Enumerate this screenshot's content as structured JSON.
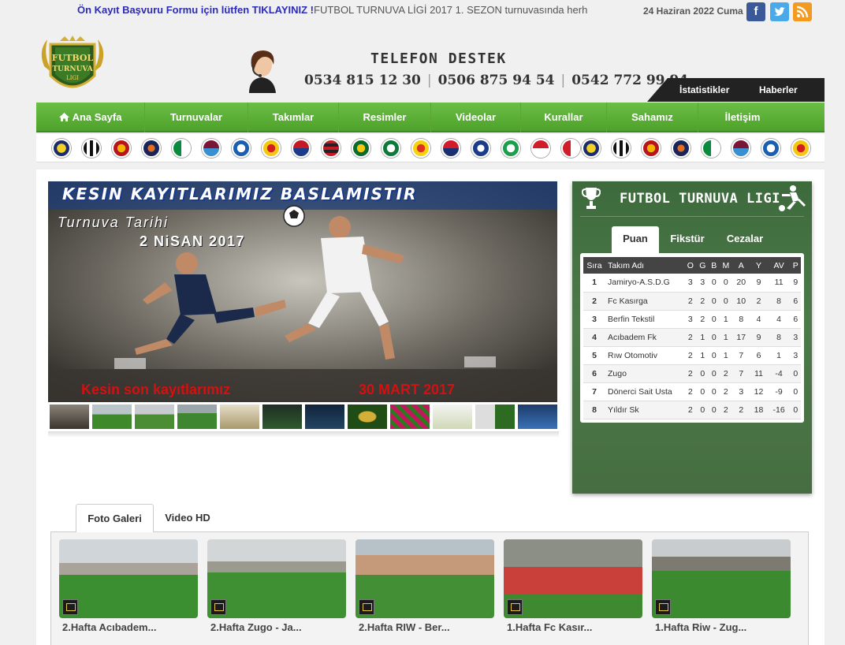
{
  "ticker": {
    "lead": "Ön Kayıt Başvuru Formu için lütfen TIKLAYINIZ !",
    "rest": "FUTBOL TURNUVA LİGİ 2017 1. SEZON turnuvasında herh"
  },
  "date": "24 Haziran 2022 Cuma",
  "social": {
    "facebook": "f",
    "twitter": "t",
    "rss": "rss"
  },
  "logo": {
    "line1": "FUTBOL",
    "line2": "TURNUVA",
    "line3": "LIGI"
  },
  "support": {
    "title": "TELEFON DESTEK",
    "phones": [
      "0534 815 12 30",
      "0506 875 94 54",
      "0542 772 99 94"
    ]
  },
  "subnav": [
    "İstatistikler",
    "Haberler"
  ],
  "nav": [
    "Ana Sayfa",
    "Turnuvalar",
    "Takımlar",
    "Resimler",
    "Videolar",
    "Kurallar",
    "Sahamız",
    "İletişim"
  ],
  "slider": {
    "title": "KESIN KAYITLARIMIZ BASLAMISTIR",
    "subtitle1": "Turnuva Tarihi",
    "subtitle2": "2 NiSAN 2017",
    "bottom_left": "Kesin son kayıtlarımız",
    "bottom_right": "30 MART 2017"
  },
  "league": {
    "title": "FUTBOL TURNUVA LIGI",
    "tabs": [
      "Puan",
      "Fikstür",
      "Cezalar"
    ],
    "columns": [
      "Sıra",
      "Takım Adı",
      "O",
      "G",
      "B",
      "M",
      "A",
      "Y",
      "AV",
      "P"
    ],
    "rows": [
      [
        "1",
        "Jamiryo-A.S.D.G",
        "3",
        "3",
        "0",
        "0",
        "20",
        "9",
        "11",
        "9"
      ],
      [
        "2",
        "Fc Kasırga",
        "2",
        "2",
        "0",
        "0",
        "10",
        "2",
        "8",
        "6"
      ],
      [
        "3",
        "Berfin Tekstil",
        "3",
        "2",
        "0",
        "1",
        "8",
        "4",
        "4",
        "6"
      ],
      [
        "4",
        "Acıbadem Fk",
        "2",
        "1",
        "0",
        "1",
        "17",
        "9",
        "8",
        "3"
      ],
      [
        "5",
        "Rıw Otomotiv",
        "2",
        "1",
        "0",
        "1",
        "7",
        "6",
        "1",
        "3"
      ],
      [
        "6",
        "Zugo",
        "2",
        "0",
        "0",
        "2",
        "7",
        "11",
        "-4",
        "0"
      ],
      [
        "7",
        "Dönerci Sait Usta",
        "2",
        "0",
        "0",
        "2",
        "3",
        "12",
        "-9",
        "0"
      ],
      [
        "8",
        "Yıldır Sk",
        "2",
        "0",
        "0",
        "2",
        "2",
        "18",
        "-16",
        "0"
      ]
    ]
  },
  "gallery": {
    "tabs": [
      "Foto Galeri",
      "Video HD"
    ],
    "items": [
      {
        "caption": "2.Hafta Acıbadem..."
      },
      {
        "caption": "2.Hafta Zugo - Ja..."
      },
      {
        "caption": "2.Hafta RIW - Ber..."
      },
      {
        "caption": "1.Hafta Fc Kasır..."
      },
      {
        "caption": "1.Hafta Riw - Zug..."
      }
    ]
  }
}
